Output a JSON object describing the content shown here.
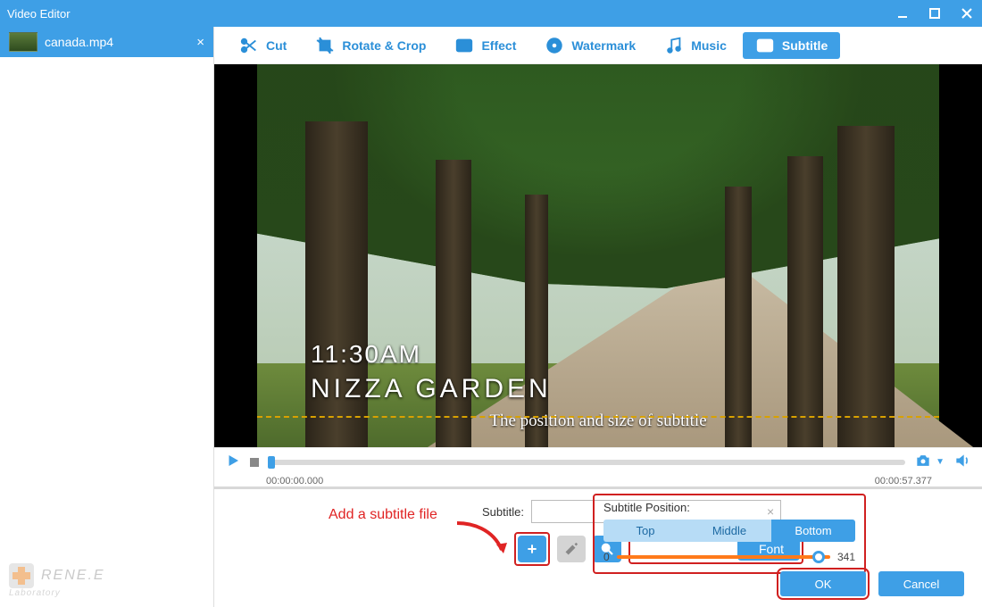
{
  "window": {
    "title": "Video Editor"
  },
  "sidebar": {
    "file_tab": "canada.mp4"
  },
  "toolbar": {
    "items": [
      {
        "label": "Cut"
      },
      {
        "label": "Rotate & Crop"
      },
      {
        "label": "Effect"
      },
      {
        "label": "Watermark"
      },
      {
        "label": "Music"
      },
      {
        "label": "Subtitle"
      }
    ]
  },
  "preview": {
    "overlay_time": "11:30AM",
    "overlay_place": "NIZZA GARDEN",
    "subtitle_sample": "The position and size of subtitle"
  },
  "playback": {
    "current_time": "00:00:00.000",
    "total_time": "00:00:57.377"
  },
  "subtitle_panel": {
    "label": "Subtitle:",
    "input_value": "",
    "font_button": "Font",
    "position_label": "Subtitle Position:",
    "positions": {
      "top": "Top",
      "middle": "Middle",
      "bottom": "Bottom"
    },
    "slider_min": "0",
    "slider_max": "341"
  },
  "annotation": {
    "text": "Add a subtitle file"
  },
  "footer": {
    "ok": "OK",
    "cancel": "Cancel"
  },
  "branding": {
    "name": "RENE.E",
    "sub": "Laboratory"
  }
}
